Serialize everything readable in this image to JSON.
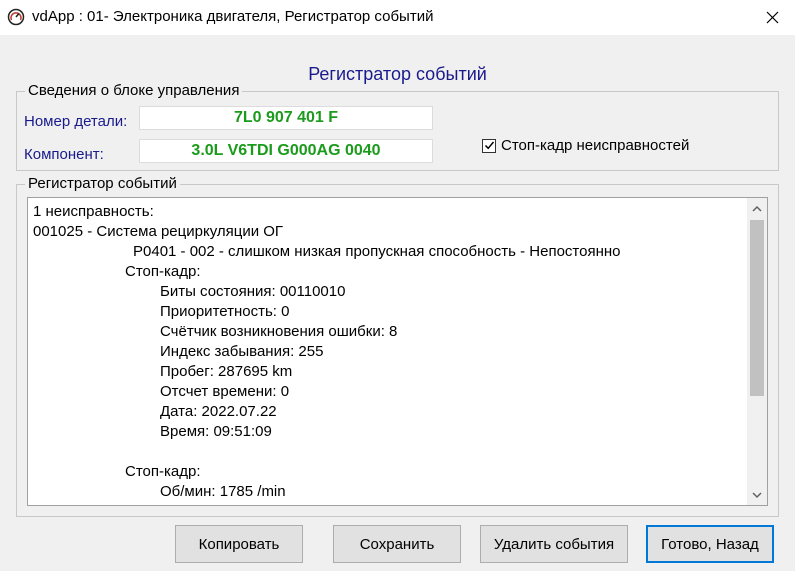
{
  "window": {
    "title": "vdApp : 01- Электроника двигателя,  Регистратор событий",
    "app_icon": "gauge-icon",
    "close_icon": "close-icon"
  },
  "heading": "Регистратор событий",
  "control_unit": {
    "legend": "Сведения о блоке управления",
    "part_number_label": "Номер детали:",
    "part_number_value": "7L0 907 401 F",
    "component_label": "Компонент:",
    "component_value": "3.0L V6TDI  G000AG  0040",
    "freeze_frame_checkbox": {
      "label": "Стоп-кадр неисправностей",
      "checked": true
    }
  },
  "event_log": {
    "legend": "Регистратор событий",
    "lines": [
      {
        "text": "1 неисправность:",
        "indent": 0
      },
      {
        "text": "001025 - Система рециркуляции ОГ",
        "indent": 0
      },
      {
        "text": "P0401 - 002 - слишком низкая пропускная способность - Непостоянно",
        "indent": 2
      },
      {
        "text": "Стоп-кадр:",
        "indent": 1
      },
      {
        "text": "Биты состояния: 00110010",
        "indent": 3
      },
      {
        "text": "Приоритетность: 0",
        "indent": 3
      },
      {
        "text": "Счётчик возникновения ошибки: 8",
        "indent": 3
      },
      {
        "text": "Индекс забывания: 255",
        "indent": 3
      },
      {
        "text": "Пробег: 287695 km",
        "indent": 3
      },
      {
        "text": "Отсчет времени: 0",
        "indent": 3
      },
      {
        "text": "Дата: 2022.07.22",
        "indent": 3
      },
      {
        "text": "Время: 09:51:09",
        "indent": 3
      },
      {
        "text": "",
        "indent": 0
      },
      {
        "text": "Стоп-кадр:",
        "indent": 1
      },
      {
        "text": "Об/мин: 1785 /min",
        "indent": 3
      }
    ]
  },
  "buttons": {
    "copy": "Копировать",
    "save": "Сохранить",
    "delete_events": "Удалить события",
    "done_back": "Готово, Назад"
  },
  "colors": {
    "label_blue": "#1a1a8c",
    "value_green": "#1b9b1b",
    "focus_border": "#0078d7"
  }
}
